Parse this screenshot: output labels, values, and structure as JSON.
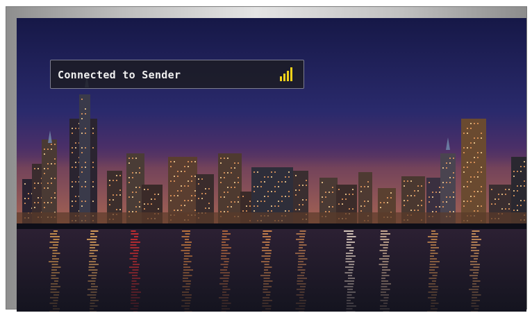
{
  "status": {
    "text": "Connected to Sender",
    "icon": "signal-strength-icon",
    "signal_level": 1.0,
    "icon_color": "#f2d21a"
  },
  "scene": {
    "subject": "city-skyline-at-night-reflected-in-water",
    "sky_color": "#1c1f5c",
    "water_color": "#1a1a2a"
  }
}
